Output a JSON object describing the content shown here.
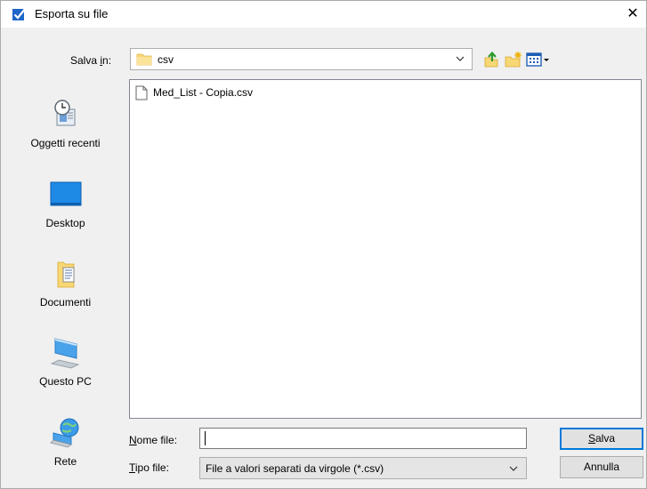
{
  "window": {
    "title": "Esporta su file",
    "close_glyph": "✕"
  },
  "savein": {
    "label_pre": "Salva ",
    "label_u": "i",
    "label_post": "n:",
    "value": "csv"
  },
  "toolbar": {
    "icons": [
      "up-folder-icon",
      "new-folder-icon",
      "view-menu-icon"
    ]
  },
  "places": [
    {
      "label": "Oggetti recenti",
      "icon": "recent-items-icon"
    },
    {
      "label": "Desktop",
      "icon": "desktop-icon"
    },
    {
      "label": "Documenti",
      "icon": "documents-icon"
    },
    {
      "label": "Questo PC",
      "icon": "computer-icon"
    },
    {
      "label": "Rete",
      "icon": "network-icon"
    }
  ],
  "files": [
    {
      "name": "Med_List - Copia.csv"
    }
  ],
  "filename": {
    "label_u": "N",
    "label_post": "ome file:",
    "value": ""
  },
  "filetype": {
    "label_u": "T",
    "label_post": "ipo file:",
    "value": "File a valori separati da virgole (*.csv)"
  },
  "buttons": {
    "save_u": "S",
    "save_post": "alva",
    "cancel": "Annulla"
  },
  "colors": {
    "accent": "#0078d7",
    "folder": "#f8d775"
  }
}
